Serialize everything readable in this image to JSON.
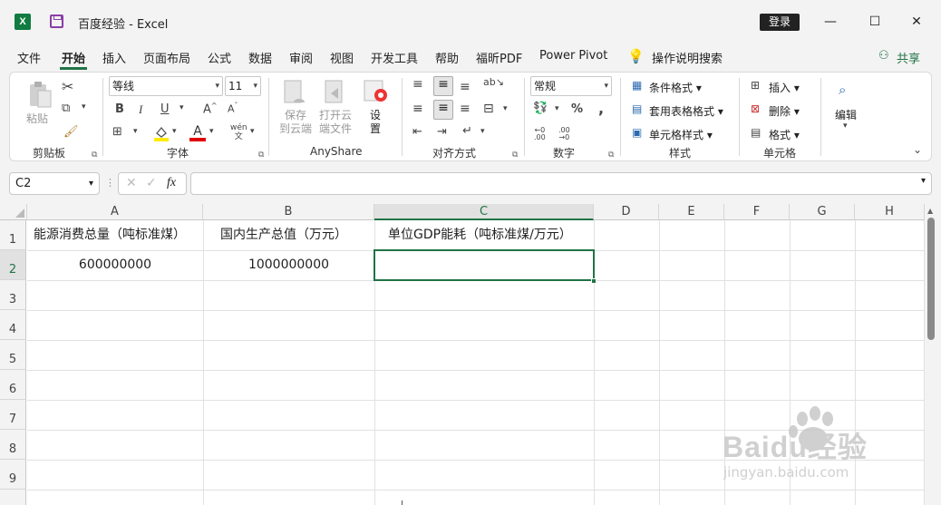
{
  "titlebar": {
    "doc_title": "百度经验  -  Excel",
    "login": "登录",
    "logo": "X"
  },
  "menu": [
    "文件",
    "开始",
    "插入",
    "页面布局",
    "公式",
    "数据",
    "审阅",
    "视图",
    "开发工具",
    "帮助",
    "福昕PDF",
    "Power Pivot",
    "操作说明搜索"
  ],
  "share": "共享",
  "ribbon": {
    "clipboard": {
      "paste": "粘贴",
      "label": "剪贴板"
    },
    "font": {
      "name": "等线",
      "size": "11",
      "label": "字体",
      "bold": "B",
      "italic": "I",
      "underline": "U",
      "grow": "A",
      "shrink": "A",
      "wen": "wén\n文"
    },
    "anyshare": {
      "save_cloud": "保存\n到云端",
      "open_cloud": "打开云\n端文件",
      "settings": "设\n置",
      "label": "AnyShare"
    },
    "align": {
      "label": "对齐方式"
    },
    "number": {
      "format": "常规",
      "percent": "%",
      "comma": ",",
      "label": "数字"
    },
    "styles": {
      "conditional": "条件格式",
      "table": "套用表格格式",
      "cell": "单元格样式",
      "label": "样式"
    },
    "cells": {
      "insert": "插入",
      "delete": "删除",
      "format": "格式",
      "label": "单元格"
    },
    "editing": {
      "label": "编辑"
    }
  },
  "namebox": "C2",
  "fx": "fx",
  "columns": [
    "A",
    "B",
    "C",
    "D",
    "E",
    "F",
    "G",
    "H"
  ],
  "rows": [
    "1",
    "2",
    "3",
    "4",
    "5",
    "6",
    "7",
    "8",
    "9"
  ],
  "cells": {
    "A1": "能源消费总量（吨标准煤）",
    "B1": "国内生产总值（万元）",
    "C1": "单位GDP能耗（吨标准煤/万元）",
    "A2": "600000000",
    "B2": "1000000000"
  },
  "watermark": {
    "brand": "Baidu经验",
    "url": "jingyan.baidu.com"
  },
  "colors": {
    "accent": "#217346",
    "excel_green": "#107c41",
    "save_purple": "#8a3fa6"
  }
}
